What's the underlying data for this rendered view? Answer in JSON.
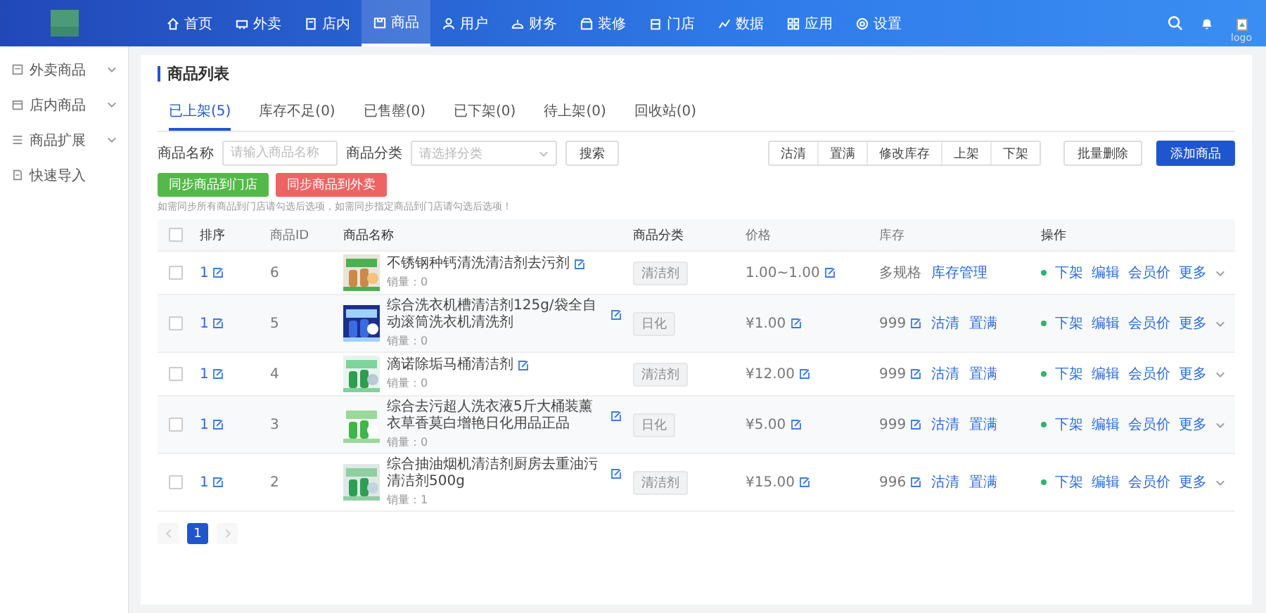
{
  "header": {
    "nav": [
      {
        "label": "首页",
        "selected": false
      },
      {
        "label": "外卖",
        "selected": false
      },
      {
        "label": "店内",
        "selected": false
      },
      {
        "label": "商品",
        "selected": true
      },
      {
        "label": "用户",
        "selected": false
      },
      {
        "label": "财务",
        "selected": false
      },
      {
        "label": "装修",
        "selected": false
      },
      {
        "label": "门店",
        "selected": false
      },
      {
        "label": "数据",
        "selected": false
      },
      {
        "label": "应用",
        "selected": false
      },
      {
        "label": "设置",
        "selected": false
      }
    ],
    "logo_alt": "logo"
  },
  "sidebar": {
    "items": [
      {
        "label": "外卖商品",
        "kind": "group"
      },
      {
        "label": "店内商品",
        "kind": "group"
      },
      {
        "label": "商品扩展",
        "kind": "group"
      },
      {
        "label": "快速导入",
        "kind": "link"
      }
    ]
  },
  "page": {
    "title": "商品列表",
    "tabs": [
      {
        "label": "已上架(5)",
        "selected": true
      },
      {
        "label": "库存不足(0)",
        "selected": false
      },
      {
        "label": "已售罄(0)",
        "selected": false
      },
      {
        "label": "已下架(0)",
        "selected": false
      },
      {
        "label": "待上架(0)",
        "selected": false
      },
      {
        "label": "回收站(0)",
        "selected": false
      }
    ],
    "filters": {
      "name_label": "商品名称",
      "name_placeholder": "请输入商品名称",
      "category_label": "商品分类",
      "category_placeholder": "请选择分类",
      "search_button": "搜索"
    },
    "batch_buttons": [
      "沽清",
      "置满",
      "修改库存",
      "上架",
      "下架"
    ],
    "delete_button": "批量删除",
    "add_button": "添加商品",
    "sync_buttons": [
      {
        "label": "同步商品到门店",
        "kind": "success"
      },
      {
        "label": "同步商品到外卖",
        "kind": "danger"
      }
    ],
    "hint": "如需同步所有商品到门店请勾选后选项，如需同步指定商品到门店请勾选后选项！",
    "table": {
      "columns": [
        "排序",
        "商品ID",
        "商品名称",
        "商品分类",
        "价格",
        "库存",
        "操作"
      ],
      "header_checked": false,
      "rows": [
        {
          "checked": false,
          "sort": "1",
          "id": "6",
          "name": "不锈钢种钙清洗清洁剂去污剂",
          "sales": "销量：0",
          "category": "清洁剂",
          "price": "1.00~1.00",
          "stock": {
            "value": "多规格",
            "editable": false,
            "links": [
              "库存管理"
            ]
          },
          "actions": [
            "下架",
            "编辑",
            "会员价",
            "更多"
          ]
        },
        {
          "checked": false,
          "sort": "1",
          "id": "5",
          "name": "综合洗衣机槽清洁剂125g/袋全自动滚筒洗衣机清洗剂",
          "sales": "销量：0",
          "category": "日化",
          "price": "¥1.00",
          "stock": {
            "value": "999",
            "editable": true,
            "links": [
              "沽清",
              "置满"
            ]
          },
          "actions": [
            "下架",
            "编辑",
            "会员价",
            "更多"
          ]
        },
        {
          "checked": false,
          "sort": "1",
          "id": "4",
          "name": "滴诺除垢马桶清洁剂",
          "sales": "销量：0",
          "category": "清洁剂",
          "price": "¥12.00",
          "stock": {
            "value": "999",
            "editable": true,
            "links": [
              "沽清",
              "置满"
            ]
          },
          "actions": [
            "下架",
            "编辑",
            "会员价",
            "更多"
          ]
        },
        {
          "checked": false,
          "sort": "1",
          "id": "3",
          "name": "综合去污超人洗衣液5斤大桶装薰衣草香莫白增艳日化用品正品",
          "sales": "销量：0",
          "category": "日化",
          "price": "¥5.00",
          "stock": {
            "value": "999",
            "editable": true,
            "links": [
              "沽清",
              "置满"
            ]
          },
          "actions": [
            "下架",
            "编辑",
            "会员价",
            "更多"
          ]
        },
        {
          "checked": false,
          "sort": "1",
          "id": "2",
          "name": "综合抽油烟机清洁剂厨房去重油污清洁剂500g",
          "sales": "销量：1",
          "category": "清洁剂",
          "price": "¥15.00",
          "stock": {
            "value": "996",
            "editable": true,
            "links": [
              "沽清",
              "置满"
            ]
          },
          "actions": [
            "下架",
            "编辑",
            "会员价",
            "更多"
          ]
        }
      ]
    },
    "pagination": {
      "pages": [
        {
          "label": "1",
          "selected": true
        }
      ],
      "prev_disabled": true,
      "next_disabled": true
    }
  }
}
